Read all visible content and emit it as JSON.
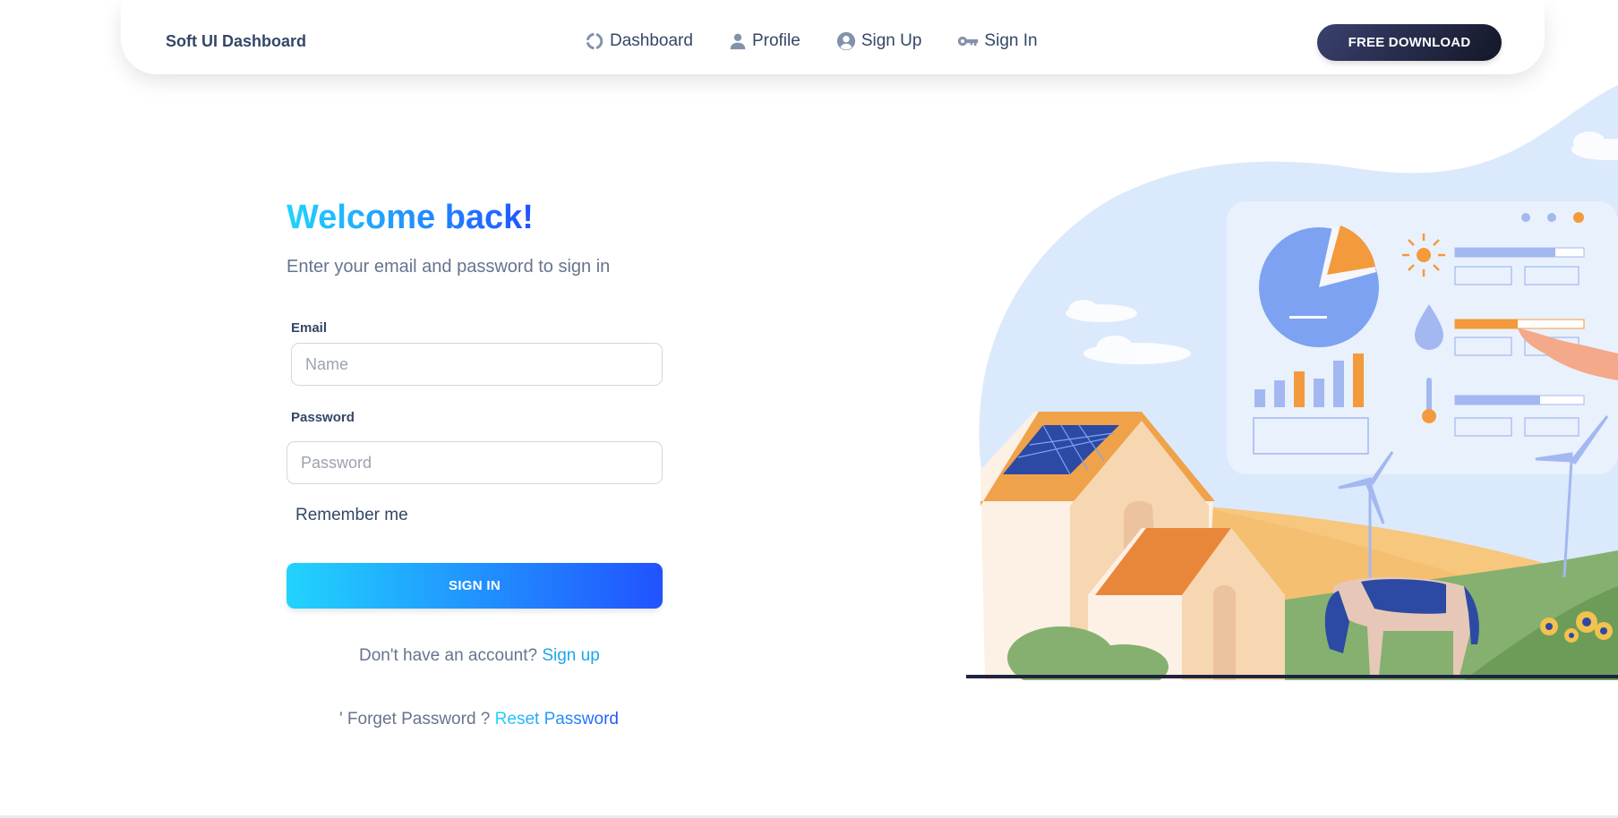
{
  "navbar": {
    "brand": "Soft UI Dashboard",
    "items": [
      {
        "label": "Dashboard",
        "icon": "dashboard-icon"
      },
      {
        "label": "Profile",
        "icon": "user-icon"
      },
      {
        "label": "Sign Up",
        "icon": "user-circle-icon"
      },
      {
        "label": "Sign In",
        "icon": "key-icon"
      }
    ],
    "download_button": "FREE DOWNLOAD"
  },
  "form": {
    "title": "Welcome back!",
    "subtitle": "Enter your email and password to sign in",
    "email_label": "Email",
    "email_placeholder": "Name",
    "password_label": "Password",
    "password_placeholder": "Password",
    "remember_label": "Remember me",
    "submit_label": "SIGN IN",
    "no_account_text": "Don't have an account?",
    "signup_link": "Sign up",
    "forget_text": "' Forget Password ?",
    "reset_link": "Reset Password"
  },
  "colors": {
    "gradient_start": "#21d4fd",
    "gradient_end": "#2152ff",
    "dark_button": "#141727",
    "text_dark": "#344767",
    "text_muted": "#67748e"
  }
}
